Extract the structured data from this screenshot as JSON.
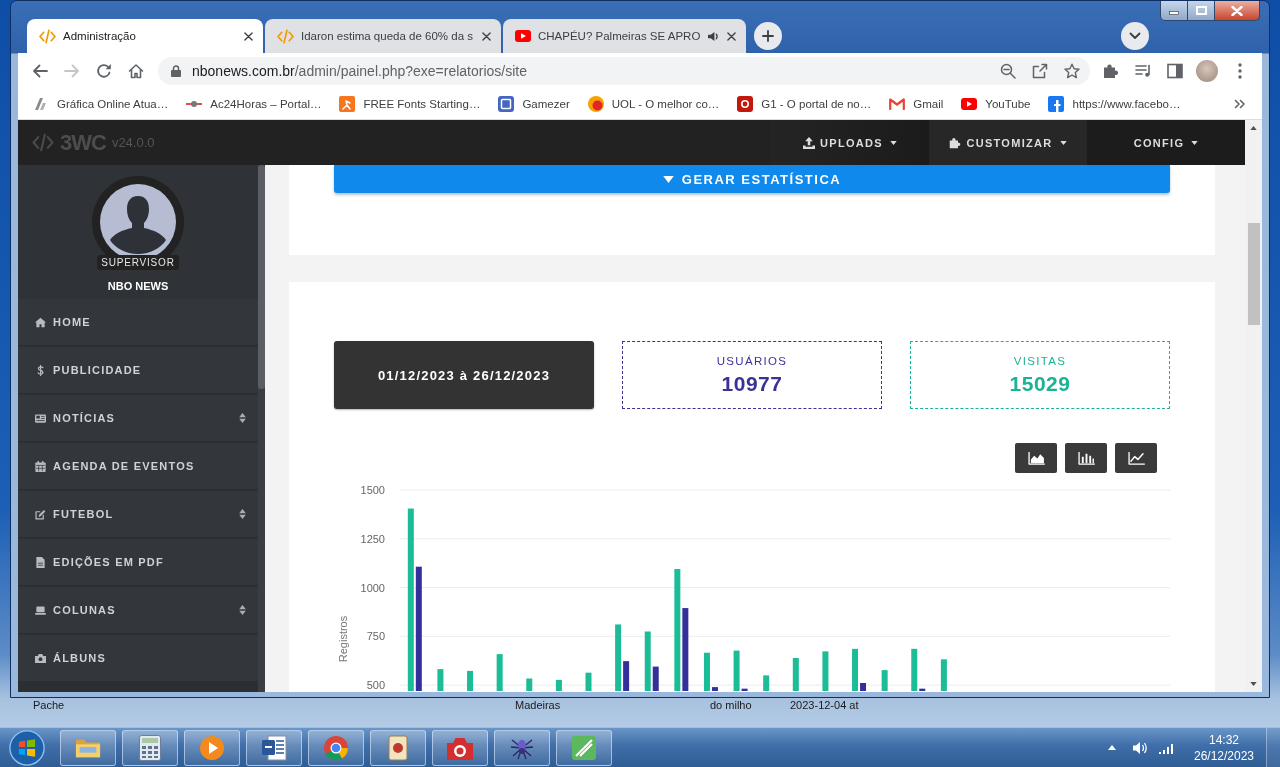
{
  "desktop": {
    "icon_labels": [
      "Pache",
      "Madeiras",
      "do milho",
      "2023-12-04 at"
    ]
  },
  "browser": {
    "tabs": [
      {
        "title": "Administração",
        "kind": "page",
        "selected": true,
        "audio": false
      },
      {
        "title": "Idaron estima queda de 60% da s",
        "kind": "page",
        "selected": false,
        "audio": false
      },
      {
        "title": "CHAPÉU? Palmeiras SE APRO",
        "kind": "video",
        "selected": false,
        "audio": true
      }
    ],
    "navigation": {
      "forward_disabled": true
    },
    "address": {
      "host": "nbonews.com.br",
      "path": "/admin/painel.php?exe=relatorios/site"
    },
    "bookmarks": [
      "Gráfica Online Atua…",
      "Ac24Horas – Portal…",
      "FREE Fonts Starting…",
      "Gamezer",
      "UOL - O melhor co…",
      "G1 - O portal de no…",
      "Gmail",
      "YouTube",
      "https://www.facebo…"
    ]
  },
  "page": {
    "navbar": {
      "logo": "3WC",
      "version": "v24.0.0",
      "menus": [
        "UPLOADS",
        "CUSTOMIZAR",
        "CONFIG"
      ]
    },
    "sidebar": {
      "role": "SUPERVISOR",
      "name": "NBO NEWS",
      "items": [
        {
          "label": "HOME",
          "submenu": false
        },
        {
          "label": "PUBLICIDADE",
          "submenu": false
        },
        {
          "label": "NOTÍCIAS",
          "submenu": true
        },
        {
          "label": "AGENDA DE EVENTOS",
          "submenu": false
        },
        {
          "label": "FUTEBOL",
          "submenu": true
        },
        {
          "label": "EDIÇÕES EM PDF",
          "submenu": false
        },
        {
          "label": "COLUNAS",
          "submenu": true
        },
        {
          "label": "ÁLBUNS",
          "submenu": false
        }
      ]
    },
    "generate_button": "GERAR ESTATÍSTICA",
    "period": "01/12/2023 à 26/12/2023",
    "stat_cards": [
      {
        "label": "USUÁRIOS",
        "value": "10977",
        "color": "#3b3296"
      },
      {
        "label": "VISITAS",
        "value": "15029",
        "color": "#1ab394"
      }
    ],
    "chart_buttons": [
      {
        "kind": "area"
      },
      {
        "kind": "bar"
      },
      {
        "kind": "line"
      }
    ],
    "chart_data": {
      "type": "bar",
      "ylabel": "Registros",
      "ylim": [
        470,
        1500
      ],
      "yticks": [
        500,
        750,
        1000,
        1250,
        1500
      ],
      "grid": true,
      "stacked": false,
      "series": [
        {
          "color": "#1bbc96",
          "values": [
            1405,
            582,
            573,
            659,
            534,
            527,
            564,
            811,
            775,
            1095,
            666,
            677,
            550,
            639,
            673,
            686,
            577,
            686,
            632,
            null,
            null,
            null,
            null,
            null,
            null,
            null
          ]
        },
        {
          "color": "#34309b",
          "values": [
            1107,
            null,
            null,
            null,
            null,
            null,
            null,
            623,
            595,
            895,
            490,
            482,
            null,
            null,
            null,
            511,
            null,
            482,
            null,
            null,
            null,
            null,
            null,
            null,
            null,
            null
          ]
        }
      ]
    }
  },
  "taskbar": {
    "clock": {
      "time": "14:32",
      "date": "26/12/2023"
    }
  }
}
